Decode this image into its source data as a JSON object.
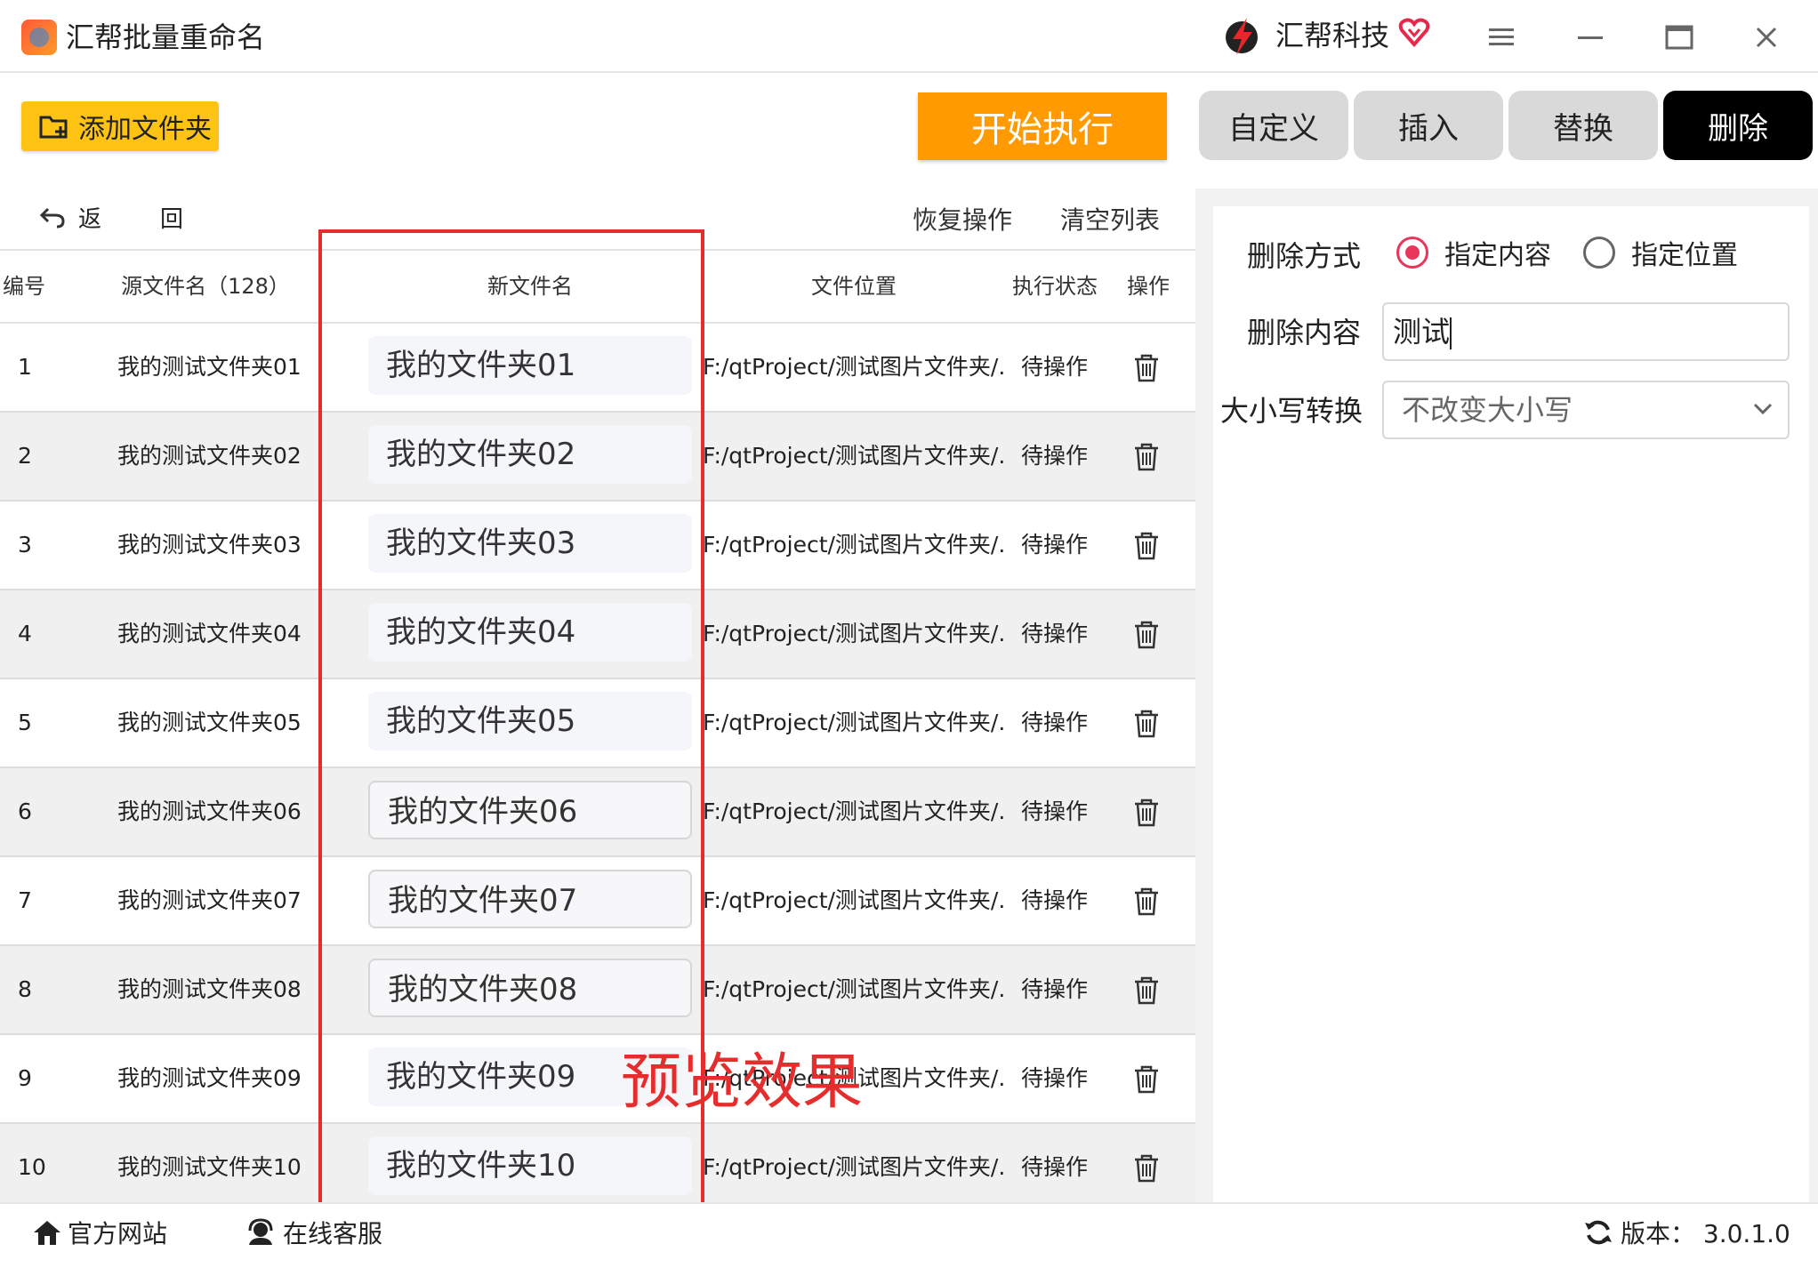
{
  "app": {
    "title": "汇帮批量重命名",
    "brand": "汇帮科技"
  },
  "toolbar": {
    "add_folder": "添加文件夹",
    "start": "开始执行"
  },
  "tabs": [
    {
      "label": "自定义",
      "active": false
    },
    {
      "label": "插入",
      "active": false
    },
    {
      "label": "替换",
      "active": false
    },
    {
      "label": "删除",
      "active": true
    }
  ],
  "subbar": {
    "back": "返　回",
    "restore": "恢复操作",
    "clear": "清空列表"
  },
  "table": {
    "headers": {
      "index": "编号",
      "source": "源文件名（128）",
      "newname": "新文件名",
      "location": "文件位置",
      "status": "执行状态",
      "action": "操作"
    },
    "rows": [
      {
        "index": "1",
        "source": "我的测试文件夹01",
        "newname": "我的文件夹01",
        "location": "F:/qtProject/测试图片文件夹/...",
        "status": "待操作"
      },
      {
        "index": "2",
        "source": "我的测试文件夹02",
        "newname": "我的文件夹02",
        "location": "F:/qtProject/测试图片文件夹/...",
        "status": "待操作"
      },
      {
        "index": "3",
        "source": "我的测试文件夹03",
        "newname": "我的文件夹03",
        "location": "F:/qtProject/测试图片文件夹/...",
        "status": "待操作"
      },
      {
        "index": "4",
        "source": "我的测试文件夹04",
        "newname": "我的文件夹04",
        "location": "F:/qtProject/测试图片文件夹/...",
        "status": "待操作"
      },
      {
        "index": "5",
        "source": "我的测试文件夹05",
        "newname": "我的文件夹05",
        "location": "F:/qtProject/测试图片文件夹/...",
        "status": "待操作"
      },
      {
        "index": "6",
        "source": "我的测试文件夹06",
        "newname": "我的文件夹06",
        "location": "F:/qtProject/测试图片文件夹/...",
        "status": "待操作"
      },
      {
        "index": "7",
        "source": "我的测试文件夹07",
        "newname": "我的文件夹07",
        "location": "F:/qtProject/测试图片文件夹/...",
        "status": "待操作"
      },
      {
        "index": "8",
        "source": "我的测试文件夹08",
        "newname": "我的文件夹08",
        "location": "F:/qtProject/测试图片文件夹/...",
        "status": "待操作"
      },
      {
        "index": "9",
        "source": "我的测试文件夹09",
        "newname": "我的文件夹09",
        "location": "F:/qtProject/测试图片文件夹/...",
        "status": "待操作"
      },
      {
        "index": "10",
        "source": "我的测试文件夹10",
        "newname": "我的文件夹10",
        "location": "F:/qtProject/测试图片文件夹/...",
        "status": "待操作"
      }
    ]
  },
  "overlay": {
    "preview": "预览效果"
  },
  "panel": {
    "mode_label": "删除方式",
    "mode_options": [
      {
        "label": "指定内容",
        "checked": true
      },
      {
        "label": "指定位置",
        "checked": false
      }
    ],
    "content_label": "删除内容",
    "content_value": "测试",
    "case_label": "大小写转换",
    "case_value": "不改变大小写"
  },
  "footer": {
    "website": "官方网站",
    "support": "在线客服",
    "version": "版本：  3.0.1.0"
  },
  "colors": {
    "accent_yellow": "#ffc413",
    "start_orange": "#ff9a00",
    "radio_red": "#e8365a",
    "overlay_red": "#e62d2d"
  }
}
